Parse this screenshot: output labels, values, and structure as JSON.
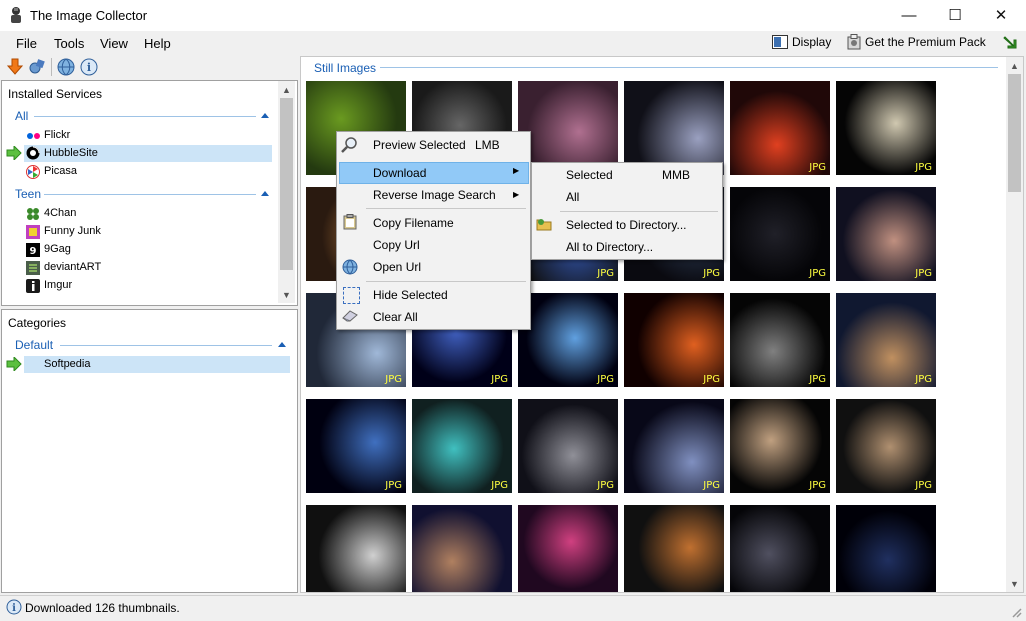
{
  "window": {
    "title": "The Image Collector",
    "minimize": "—",
    "maximize": "☐",
    "close": "✕"
  },
  "menubar": {
    "items": [
      "File",
      "Tools",
      "View",
      "Help"
    ]
  },
  "right_toolbar": {
    "display": "Display",
    "premium": "Get the Premium Pack"
  },
  "services": {
    "title": "Installed Services",
    "groups": [
      {
        "name": "All",
        "items": [
          "Flickr",
          "HubbleSite",
          "Picasa"
        ],
        "selected": "HubbleSite"
      },
      {
        "name": "Teen",
        "items": [
          "4Chan",
          "Funny Junk",
          "9Gag",
          "deviantART",
          "Imgur"
        ]
      }
    ]
  },
  "categories": {
    "title": "Categories",
    "group": "Default",
    "items": [
      "Softpedia"
    ]
  },
  "main": {
    "section_label": "Still Images",
    "badge": "JPG"
  },
  "context_menu": {
    "items": [
      {
        "label": "Preview Selected",
        "shortcut": "LMB"
      },
      {
        "label": "Download"
      },
      {
        "label": "Reverse Image Search"
      },
      {
        "label": "Copy Filename"
      },
      {
        "label": "Copy Url"
      },
      {
        "label": "Open Url"
      },
      {
        "label": "Hide Selected"
      },
      {
        "label": "Clear All"
      }
    ]
  },
  "submenu": {
    "items": [
      {
        "label": "Selected",
        "shortcut": "MMB"
      },
      {
        "label": "All"
      },
      {
        "label": "Selected to Directory..."
      },
      {
        "label": "All to Directory..."
      }
    ]
  },
  "status": {
    "text": "Downloaded 126 thumbnails."
  },
  "colors": {
    "accent": "#1a5fb4",
    "selection": "#cce4f7",
    "menu_highlight": "#91c9f7",
    "badge": "#ffff40"
  }
}
